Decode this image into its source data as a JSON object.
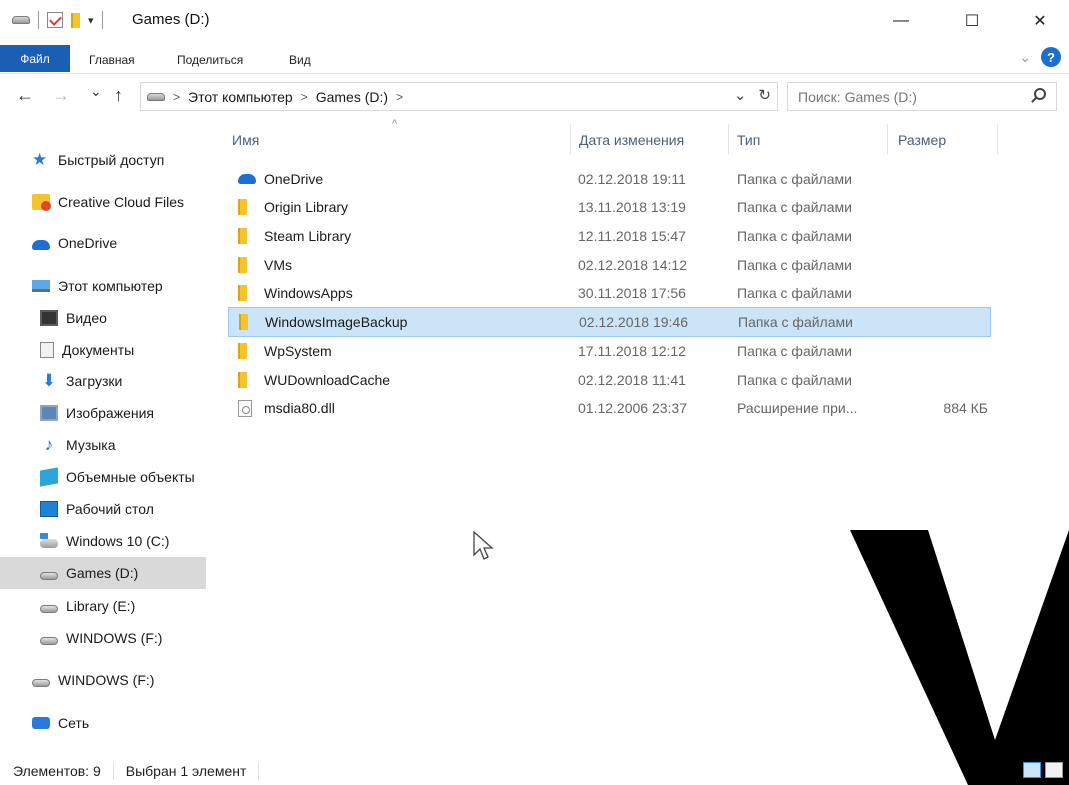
{
  "window": {
    "title": "Games (D:)",
    "controls": {
      "minimize": "—",
      "maximize": "☐",
      "close": "✕"
    }
  },
  "ribbon": {
    "tabs": [
      "Файл",
      "Главная",
      "Поделиться",
      "Вид"
    ],
    "help": "?"
  },
  "address": {
    "back": "←",
    "forward": "→",
    "recent": "⌄",
    "up": "↑",
    "segments": [
      "Этот компьютер",
      "Games (D:)"
    ],
    "separator": ">",
    "refresh": "↻",
    "dropdown": "⌄"
  },
  "search": {
    "placeholder": "Поиск: Games (D:)"
  },
  "sidebar": {
    "items": [
      {
        "label": "Быстрый доступ",
        "icon": "star-icon"
      },
      {
        "label": "Creative Cloud Files",
        "icon": "creative-cloud-icon"
      },
      {
        "label": "OneDrive",
        "icon": "onedrive-icon"
      },
      {
        "label": "Этот компьютер",
        "icon": "computer-icon"
      },
      {
        "label": "Видео",
        "icon": "video-icon"
      },
      {
        "label": "Документы",
        "icon": "documents-icon"
      },
      {
        "label": "Загрузки",
        "icon": "downloads-icon"
      },
      {
        "label": "Изображения",
        "icon": "pictures-icon"
      },
      {
        "label": "Музыка",
        "icon": "music-icon"
      },
      {
        "label": "Объемные объекты",
        "icon": "3d-objects-icon"
      },
      {
        "label": "Рабочий стол",
        "icon": "desktop-icon"
      },
      {
        "label": "Windows 10 (C:)",
        "icon": "windows-drive-icon"
      },
      {
        "label": "Games (D:)",
        "icon": "drive-icon",
        "selected": true
      },
      {
        "label": "Library (E:)",
        "icon": "drive-icon"
      },
      {
        "label": "WINDOWS (F:)",
        "icon": "drive-icon"
      },
      {
        "label": "WINDOWS (F:)",
        "icon": "drive-icon"
      },
      {
        "label": "Сеть",
        "icon": "network-icon"
      }
    ]
  },
  "columns": {
    "name": "Имя",
    "date": "Дата изменения",
    "type": "Тип",
    "size": "Размер"
  },
  "files": [
    {
      "name": "OneDrive",
      "date": "02.12.2018 19:11",
      "type": "Папка с файлами",
      "size": "",
      "icon": "onedrive-icon"
    },
    {
      "name": "Origin Library",
      "date": "13.11.2018 13:19",
      "type": "Папка с файлами",
      "size": "",
      "icon": "folder-icon"
    },
    {
      "name": "Steam Library",
      "date": "12.11.2018 15:47",
      "type": "Папка с файлами",
      "size": "",
      "icon": "folder-icon"
    },
    {
      "name": "VMs",
      "date": "02.12.2018 14:12",
      "type": "Папка с файлами",
      "size": "",
      "icon": "folder-icon"
    },
    {
      "name": "WindowsApps",
      "date": "30.11.2018 17:56",
      "type": "Папка с файлами",
      "size": "",
      "icon": "folder-icon"
    },
    {
      "name": "WindowsImageBackup",
      "date": "02.12.2018 19:46",
      "type": "Папка с файлами",
      "size": "",
      "icon": "folder-icon",
      "selected": true
    },
    {
      "name": "WpSystem",
      "date": "17.11.2018 12:12",
      "type": "Папка с файлами",
      "size": "",
      "icon": "folder-icon"
    },
    {
      "name": "WUDownloadCache",
      "date": "02.12.2018 11:41",
      "type": "Папка с файлами",
      "size": "",
      "icon": "folder-icon"
    },
    {
      "name": "msdia80.dll",
      "date": "01.12.2006 23:37",
      "type": "Расширение при...",
      "size": "884 КБ",
      "icon": "dll-file-icon"
    }
  ],
  "status": {
    "count": "Элементов: 9",
    "selection": "Выбран 1 элемент"
  },
  "colors": {
    "accent": "#1a5fb4",
    "selection": "#cce4f7",
    "sidebar_selected": "#d9d9d9"
  }
}
